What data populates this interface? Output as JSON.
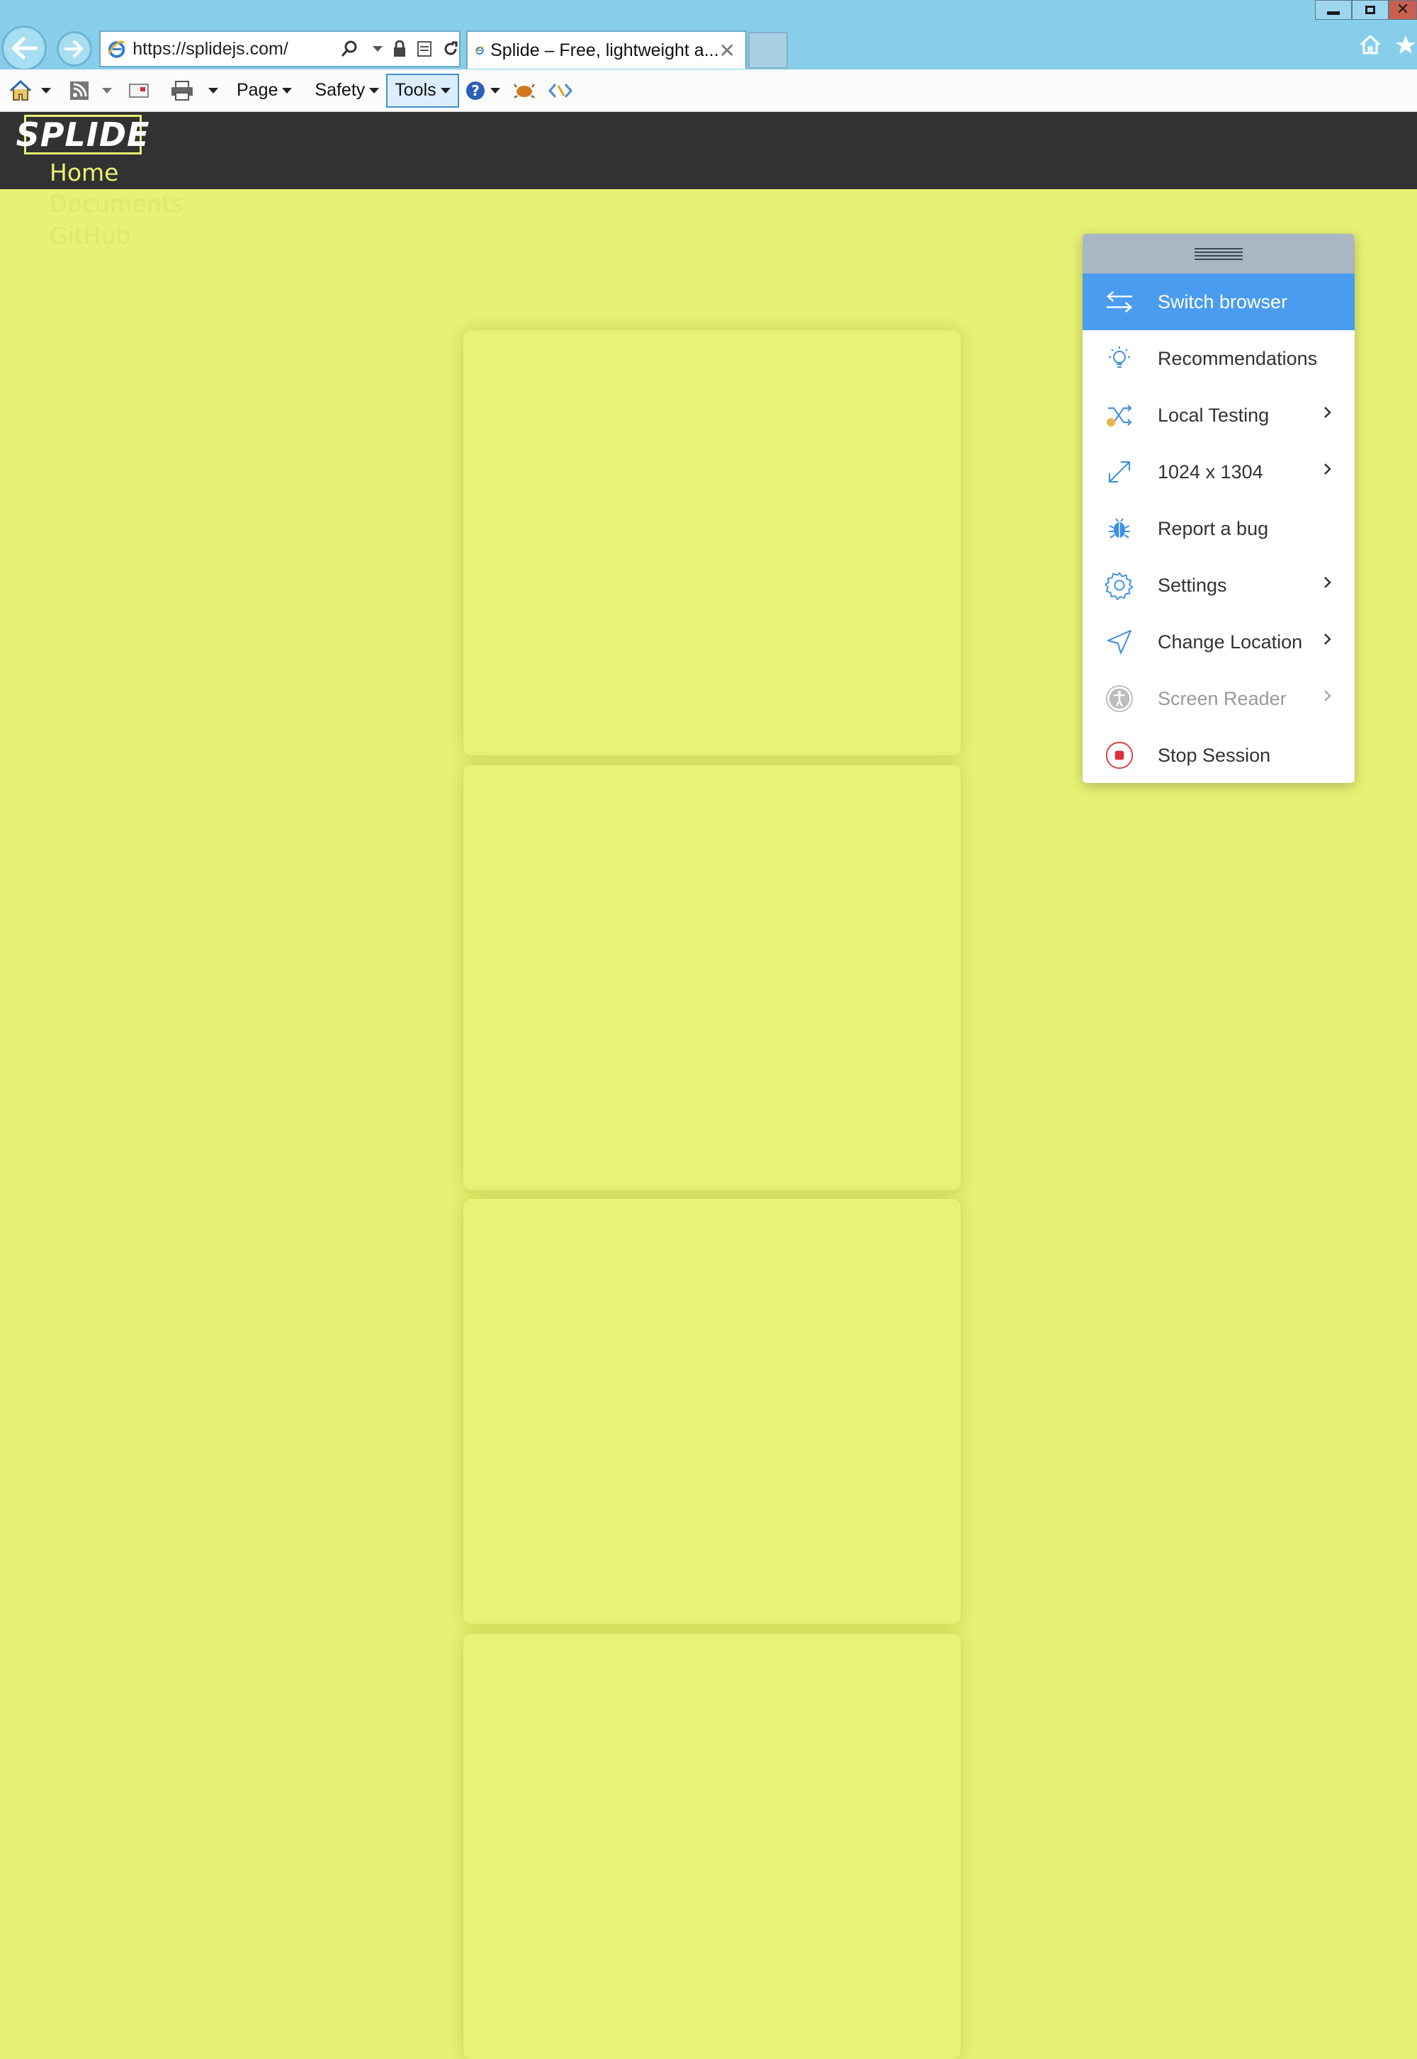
{
  "browser": {
    "url": "https://splidejs.com/",
    "tab_title": "Splide – Free, lightweight a...",
    "command_bar": {
      "page": "Page",
      "safety": "Safety",
      "tools": "Tools"
    }
  },
  "site": {
    "logo": "SPLIDE",
    "nav": [
      "Home",
      "Documents",
      "GitHub"
    ],
    "accent_color": "#e7f274",
    "header_color": "#323232"
  },
  "menu": {
    "items": [
      {
        "label": "Switch browser",
        "icon": "switch-arrows-icon",
        "submenu": false
      },
      {
        "label": "Recommendations",
        "icon": "lightbulb-icon",
        "submenu": false
      },
      {
        "label": "Local Testing",
        "icon": "shuffle-icon",
        "submenu": true
      },
      {
        "label": "1024 x 1304",
        "icon": "resize-icon",
        "submenu": true
      },
      {
        "label": "Report a bug",
        "icon": "bug-icon",
        "submenu": false
      },
      {
        "label": "Settings",
        "icon": "gear-icon",
        "submenu": true
      },
      {
        "label": "Change Location",
        "icon": "location-arrow-icon",
        "submenu": true
      },
      {
        "label": "Screen Reader",
        "icon": "accessibility-icon",
        "submenu": true
      },
      {
        "label": "Stop Session",
        "icon": "stop-icon",
        "submenu": false
      }
    ],
    "active_color": "#4a9cf0"
  }
}
